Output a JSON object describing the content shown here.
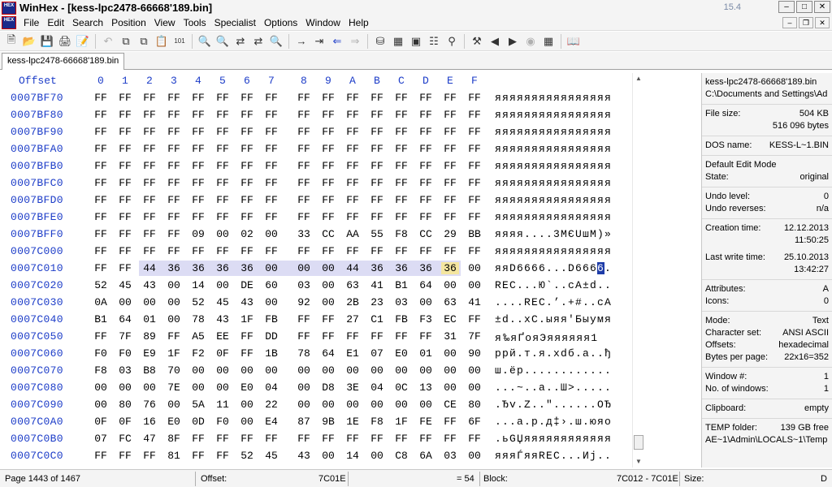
{
  "window": {
    "title": "WinHex - [kess-lpc2478-66668'189.bin]",
    "version": "15.4",
    "logo_text": "HEX"
  },
  "menu": [
    "File",
    "Edit",
    "Search",
    "Position",
    "View",
    "Tools",
    "Specialist",
    "Options",
    "Window",
    "Help"
  ],
  "toolbar": {
    "icons": [
      "new-file-icon",
      "open-file-icon",
      "save-icon",
      "print-icon",
      "properties-icon",
      "sep",
      "undo-icon",
      "copy-icon",
      "copy-block-icon",
      "paste-icon",
      "binary-icon",
      "sep",
      "find-text-icon",
      "find-hex-icon",
      "replace-text-icon",
      "replace-hex-icon",
      "find-again-icon",
      "sep",
      "goto-offset-icon",
      "goto-marker-icon",
      "back-icon",
      "forward-icon",
      "sep",
      "open-disk-icon",
      "disk-tools-icon",
      "ram-icon",
      "calculator-icon",
      "analyze-icon",
      "sep",
      "tools-icon",
      "prev-icon",
      "next-icon",
      "camera-icon",
      "table-icon",
      "sep",
      "help-book-icon"
    ]
  },
  "tab": {
    "label": "kess-lpc2478-66668'189.bin"
  },
  "hex": {
    "offset_header": "Offset",
    "columns": [
      "0",
      "1",
      "2",
      "3",
      "4",
      "5",
      "6",
      "7",
      "8",
      "9",
      "A",
      "B",
      "C",
      "D",
      "E",
      "F"
    ],
    "rows": [
      {
        "offset": "0007BF70",
        "bytes": [
          "FF",
          "FF",
          "FF",
          "FF",
          "FF",
          "FF",
          "FF",
          "FF",
          "FF",
          "FF",
          "FF",
          "FF",
          "FF",
          "FF",
          "FF",
          "FF"
        ],
        "ascii": "яяяяяяяяяяяяяяяя"
      },
      {
        "offset": "0007BF80",
        "bytes": [
          "FF",
          "FF",
          "FF",
          "FF",
          "FF",
          "FF",
          "FF",
          "FF",
          "FF",
          "FF",
          "FF",
          "FF",
          "FF",
          "FF",
          "FF",
          "FF"
        ],
        "ascii": "яяяяяяяяяяяяяяяя"
      },
      {
        "offset": "0007BF90",
        "bytes": [
          "FF",
          "FF",
          "FF",
          "FF",
          "FF",
          "FF",
          "FF",
          "FF",
          "FF",
          "FF",
          "FF",
          "FF",
          "FF",
          "FF",
          "FF",
          "FF"
        ],
        "ascii": "яяяяяяяяяяяяяяяя"
      },
      {
        "offset": "0007BFA0",
        "bytes": [
          "FF",
          "FF",
          "FF",
          "FF",
          "FF",
          "FF",
          "FF",
          "FF",
          "FF",
          "FF",
          "FF",
          "FF",
          "FF",
          "FF",
          "FF",
          "FF"
        ],
        "ascii": "яяяяяяяяяяяяяяяя"
      },
      {
        "offset": "0007BFB0",
        "bytes": [
          "FF",
          "FF",
          "FF",
          "FF",
          "FF",
          "FF",
          "FF",
          "FF",
          "FF",
          "FF",
          "FF",
          "FF",
          "FF",
          "FF",
          "FF",
          "FF"
        ],
        "ascii": "яяяяяяяяяяяяяяяя"
      },
      {
        "offset": "0007BFC0",
        "bytes": [
          "FF",
          "FF",
          "FF",
          "FF",
          "FF",
          "FF",
          "FF",
          "FF",
          "FF",
          "FF",
          "FF",
          "FF",
          "FF",
          "FF",
          "FF",
          "FF"
        ],
        "ascii": "яяяяяяяяяяяяяяяя"
      },
      {
        "offset": "0007BFD0",
        "bytes": [
          "FF",
          "FF",
          "FF",
          "FF",
          "FF",
          "FF",
          "FF",
          "FF",
          "FF",
          "FF",
          "FF",
          "FF",
          "FF",
          "FF",
          "FF",
          "FF"
        ],
        "ascii": "яяяяяяяяяяяяяяяя"
      },
      {
        "offset": "0007BFE0",
        "bytes": [
          "FF",
          "FF",
          "FF",
          "FF",
          "FF",
          "FF",
          "FF",
          "FF",
          "FF",
          "FF",
          "FF",
          "FF",
          "FF",
          "FF",
          "FF",
          "FF"
        ],
        "ascii": "яяяяяяяяяяяяяяяя"
      },
      {
        "offset": "0007BFF0",
        "bytes": [
          "FF",
          "FF",
          "FF",
          "FF",
          "09",
          "00",
          "02",
          "00",
          "33",
          "CC",
          "AA",
          "55",
          "F8",
          "CC",
          "29",
          "BB"
        ],
        "ascii": "яяяя....3МЄUшМ)»"
      },
      {
        "offset": "0007C000",
        "bytes": [
          "FF",
          "FF",
          "FF",
          "FF",
          "FF",
          "FF",
          "FF",
          "FF",
          "FF",
          "FF",
          "FF",
          "FF",
          "FF",
          "FF",
          "FF",
          "FF"
        ],
        "ascii": "яяяяяяяяяяяяяяяя"
      },
      {
        "offset": "0007C010",
        "bytes": [
          "FF",
          "FF",
          "44",
          "36",
          "36",
          "36",
          "36",
          "00",
          "00",
          "00",
          "44",
          "36",
          "36",
          "36",
          "36",
          "00"
        ],
        "ascii": "яяD6666...D6666."
      },
      {
        "offset": "0007C020",
        "bytes": [
          "52",
          "45",
          "43",
          "00",
          "14",
          "00",
          "DE",
          "60",
          "03",
          "00",
          "63",
          "41",
          "B1",
          "64",
          "00",
          "00"
        ],
        "ascii": "REC...Ю`..cA±d.."
      },
      {
        "offset": "0007C030",
        "bytes": [
          "0A",
          "00",
          "00",
          "00",
          "52",
          "45",
          "43",
          "00",
          "92",
          "00",
          "2B",
          "23",
          "03",
          "00",
          "63",
          "41"
        ],
        "ascii": "....REC.’.+#..cA"
      },
      {
        "offset": "0007C040",
        "bytes": [
          "B1",
          "64",
          "01",
          "00",
          "78",
          "43",
          "1F",
          "FB",
          "FF",
          "FF",
          "27",
          "C1",
          "FB",
          "F3",
          "EC",
          "FF"
        ],
        "ascii": "±d..xC.ыяя'Быумя"
      },
      {
        "offset": "0007C050",
        "bytes": [
          "FF",
          "7F",
          "89",
          "FF",
          "A5",
          "EE",
          "FF",
          "DD",
          "FF",
          "FF",
          "FF",
          "FF",
          "FF",
          "FF",
          "31",
          "7F"
        ],
        "ascii": "я‰яҐояЭяяяяяя1"
      },
      {
        "offset": "0007C060",
        "bytes": [
          "F0",
          "F0",
          "E9",
          "1F",
          "F2",
          "0F",
          "FF",
          "1B",
          "78",
          "64",
          "E1",
          "07",
          "E0",
          "01",
          "00",
          "90"
        ],
        "ascii": "ррй.т.я.xdб.а..ђ"
      },
      {
        "offset": "0007C070",
        "bytes": [
          "F8",
          "03",
          "B8",
          "70",
          "00",
          "00",
          "00",
          "00",
          "00",
          "00",
          "00",
          "00",
          "00",
          "00",
          "00",
          "00"
        ],
        "ascii": "ш.ёр............"
      },
      {
        "offset": "0007C080",
        "bytes": [
          "00",
          "00",
          "00",
          "7E",
          "00",
          "00",
          "E0",
          "04",
          "00",
          "D8",
          "3E",
          "04",
          "0C",
          "13",
          "00",
          "00"
        ],
        "ascii": "...~..а..Ш>....."
      },
      {
        "offset": "0007C090",
        "bytes": [
          "00",
          "80",
          "76",
          "00",
          "5A",
          "11",
          "00",
          "22",
          "00",
          "00",
          "00",
          "00",
          "00",
          "00",
          "CE",
          "80"
        ],
        "ascii": ".Ђv.Z..\"......ОЂ"
      },
      {
        "offset": "0007C0A0",
        "bytes": [
          "0F",
          "0F",
          "16",
          "E0",
          "0D",
          "F0",
          "00",
          "E4",
          "87",
          "9B",
          "1E",
          "F8",
          "1F",
          "FE",
          "FF",
          "6F"
        ],
        "ascii": "...а.р.д‡›.ш.юяo"
      },
      {
        "offset": "0007C0B0",
        "bytes": [
          "07",
          "FC",
          "47",
          "8F",
          "FF",
          "FF",
          "FF",
          "FF",
          "FF",
          "FF",
          "FF",
          "FF",
          "FF",
          "FF",
          "FF",
          "FF"
        ],
        "ascii": ".ьGЏяяяяяяяяяяяя"
      },
      {
        "offset": "0007C0C0",
        "bytes": [
          "FF",
          "FF",
          "FF",
          "81",
          "FF",
          "FF",
          "52",
          "45",
          "43",
          "00",
          "14",
          "00",
          "C8",
          "6A",
          "03",
          "00"
        ],
        "ascii": "яяяЃяяREC...Иj.."
      }
    ]
  },
  "info": {
    "file_name": "kess-lpc2478-66668'189.bin",
    "file_path": "C:\\Documents and Settings\\Ad",
    "file_size_label": "File size:",
    "file_size_kb": "504 KB",
    "file_size_bytes": "516 096 bytes",
    "dos_name_label": "DOS name:",
    "dos_name": "KESS-L~1.BIN",
    "edit_mode": "Default Edit Mode",
    "state_label": "State:",
    "state": "original",
    "undo_level_label": "Undo level:",
    "undo_level": "0",
    "undo_reverses_label": "Undo reverses:",
    "undo_reverses": "n/a",
    "creation_label": "Creation time:",
    "creation_date": "12.12.2013",
    "creation_time": "11:50:25",
    "lastwrite_label": "Last write time:",
    "lastwrite_date": "25.10.2013",
    "lastwrite_time": "13:42:27",
    "attributes_label": "Attributes:",
    "attributes": "A",
    "icons_label": "Icons:",
    "icons": "0",
    "mode_label": "Mode:",
    "mode": "Text",
    "charset_label": "Character set:",
    "charset": "ANSI ASCII",
    "offsets_label": "Offsets:",
    "offsets": "hexadecimal",
    "bpp_label": "Bytes per page:",
    "bpp": "22x16=352",
    "window_num_label": "Window #:",
    "window_num": "1",
    "num_windows_label": "No. of windows:",
    "num_windows": "1",
    "clipboard_label": "Clipboard:",
    "clipboard": "empty",
    "temp_label": "TEMP folder:",
    "temp_free": "139 GB free",
    "temp_path": "AE~1\\Admin\\LOCALS~1\\Temp"
  },
  "status": {
    "page": "Page 1443 of 1467",
    "offset_label": "Offset:",
    "offset": "7C01E",
    "value": "= 54",
    "block_label": "Block:",
    "block": "7C012 - 7C01E",
    "size_label": "Size:",
    "size": "D"
  },
  "colors": {
    "offset_blue": "#1c3cc8",
    "selection": "#dcdcf4",
    "cursor": "#1e3ca8"
  }
}
